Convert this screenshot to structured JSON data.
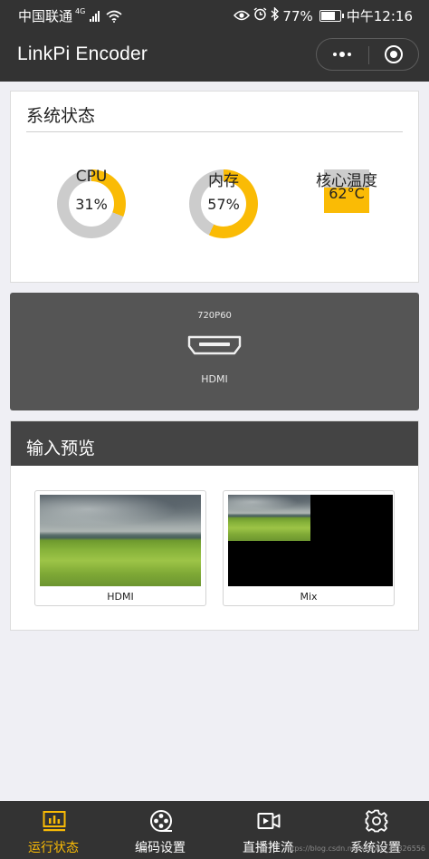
{
  "status_bar": {
    "carrier": "中国联通",
    "network": "4G",
    "battery": "77%",
    "time": "中午12:16"
  },
  "title_bar": {
    "title": "LinkPi Encoder"
  },
  "system_status": {
    "title": "系统状态",
    "cpu": {
      "value": "31%",
      "label": "CPU",
      "percent": 31
    },
    "memory": {
      "value": "57%",
      "label": "内存",
      "percent": 57
    },
    "temperature": {
      "value": "62°C",
      "label": "核心温度"
    }
  },
  "hdmi_input": {
    "resolution": "720P60",
    "name": "HDMI"
  },
  "preview": {
    "title": "输入预览",
    "items": [
      {
        "label": "HDMI"
      },
      {
        "label": "Mix"
      }
    ]
  },
  "tabs": [
    {
      "label": "运行状态",
      "icon": "monitor-chart-icon",
      "active": true
    },
    {
      "label": "编码设置",
      "icon": "film-reel-icon",
      "active": false
    },
    {
      "label": "直播推流",
      "icon": "video-camera-icon",
      "active": false
    },
    {
      "label": "系统设置",
      "icon": "gear-icon",
      "active": false
    }
  ],
  "colors": {
    "accent": "#fabb05",
    "gauge_track": "#cccccc",
    "bar_bg": "#333333"
  },
  "watermark": "https://blog.csdn.net/weixin_48326556"
}
